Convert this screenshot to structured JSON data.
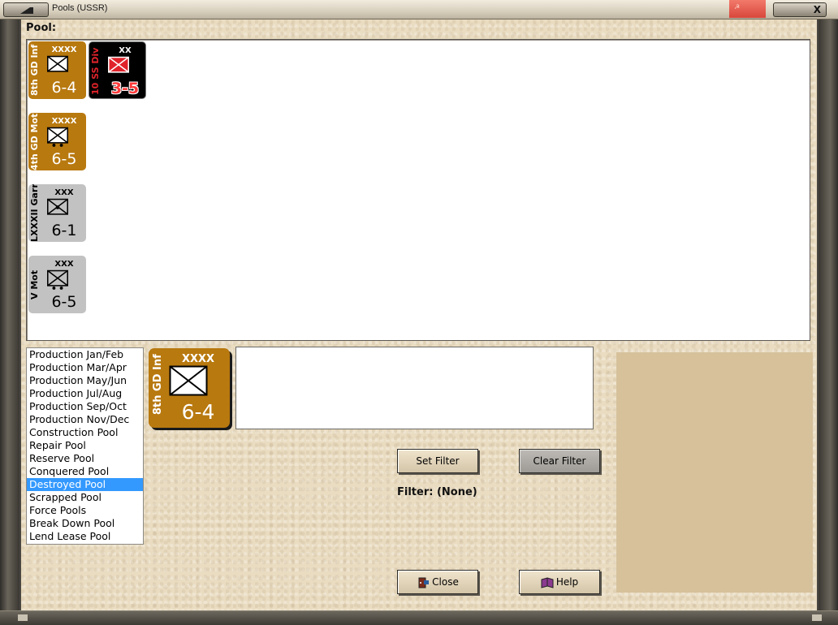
{
  "window": {
    "title": "Pools (USSR)",
    "red_button_label": "☭",
    "close_label": "X"
  },
  "pool_label": "Pool:",
  "pool_units": [
    {
      "name": "8th GD Inf",
      "size": "XXXX",
      "strength": "6-4",
      "style": "gold",
      "symbol": "infantry"
    },
    {
      "name": "10 SS Div",
      "size": "XX",
      "strength": "3-5",
      "style": "black",
      "symbol": "infantry"
    },
    {
      "name": "4th GD Mot",
      "size": "XXXX",
      "strength": "6-5",
      "style": "gold",
      "symbol": "motorized"
    },
    {
      "name": "LXXXII Garr",
      "size": "XXX",
      "strength": "6-1",
      "style": "gray",
      "symbol": "garrison"
    },
    {
      "name": "V Mot",
      "size": "XXX",
      "strength": "6-5",
      "style": "gray",
      "symbol": "motorized"
    }
  ],
  "pool_list": {
    "items": [
      "Production Jan/Feb",
      "Production Mar/Apr",
      "Production May/Jun",
      "Production Jul/Aug",
      "Production Sep/Oct",
      "Production Nov/Dec",
      "Construction Pool",
      "Repair Pool",
      "Reserve Pool",
      "Conquered Pool",
      "Destroyed Pool",
      "Scrapped Pool",
      "Force Pools",
      "Break Down Pool",
      "Lend Lease Pool"
    ],
    "selected": "Destroyed Pool"
  },
  "selected_unit": {
    "name": "8th GD Inf",
    "size": "XXXX",
    "strength": "6-4"
  },
  "buttons": {
    "set_filter": "Set Filter",
    "clear_filter": "Clear Filter",
    "close": "Close",
    "help": "Help"
  },
  "filter_status": "Filter: (None)",
  "colors": {
    "counter_gold": "#b8790f",
    "counter_black": "#000000",
    "counter_gray": "#c2c2c2",
    "selection": "#3399ff",
    "panel_bg": "#e9dcc1"
  }
}
